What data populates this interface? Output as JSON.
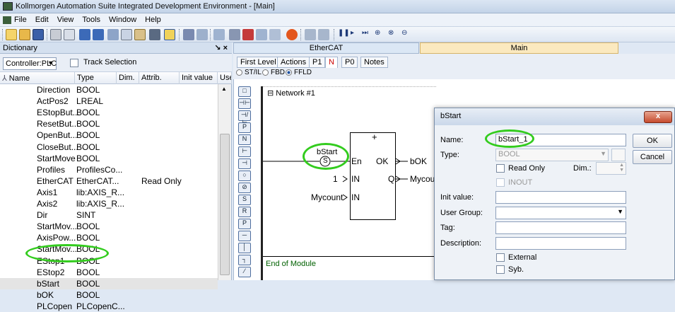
{
  "window": {
    "title": "Kollmorgen Automation Suite Integrated Development Environment - [Main]"
  },
  "menu": [
    "File",
    "Edit",
    "View",
    "Tools",
    "Window",
    "Help"
  ],
  "dictionary": {
    "title": "Dictionary",
    "header_controls": "↘ ×",
    "controller_combo": "Controller:PLC",
    "track_selection_label": "Track Selection",
    "columns": [
      "Name",
      "Type",
      "Dim.",
      "Attrib.",
      "Init value",
      "Use"
    ],
    "rows": [
      {
        "name": "Direction",
        "type": "BOOL",
        "attrib": ""
      },
      {
        "name": "ActPos2",
        "type": "LREAL",
        "attrib": ""
      },
      {
        "name": "EStopBut...",
        "type": "BOOL",
        "attrib": ""
      },
      {
        "name": "ResetBut...",
        "type": "BOOL",
        "attrib": ""
      },
      {
        "name": "OpenBut...",
        "type": "BOOL",
        "attrib": ""
      },
      {
        "name": "CloseBut...",
        "type": "BOOL",
        "attrib": ""
      },
      {
        "name": "StartMove",
        "type": "BOOL",
        "attrib": ""
      },
      {
        "name": "Profiles",
        "type": "ProfilesCo...",
        "attrib": ""
      },
      {
        "name": "EtherCAT",
        "type": "EtherCAT...",
        "attrib": "Read Only"
      },
      {
        "name": "Axis1",
        "type": "lib:AXIS_R...",
        "attrib": ""
      },
      {
        "name": "Axis2",
        "type": "lib:AXIS_R...",
        "attrib": ""
      },
      {
        "name": "Dir",
        "type": "SINT",
        "attrib": ""
      },
      {
        "name": "StartMov...",
        "type": "BOOL",
        "attrib": ""
      },
      {
        "name": "AxisPow...",
        "type": "BOOL",
        "attrib": ""
      },
      {
        "name": "StartMov...",
        "type": "BOOL",
        "attrib": ""
      },
      {
        "name": "EStop1",
        "type": "BOOL",
        "attrib": ""
      },
      {
        "name": "EStop2",
        "type": "BOOL",
        "attrib": ""
      },
      {
        "name": "bStart",
        "type": "BOOL",
        "attrib": ""
      },
      {
        "name": "bOK",
        "type": "BOOL",
        "attrib": ""
      },
      {
        "name": "PLCopen",
        "type": "PLCopenC...",
        "attrib": ""
      }
    ]
  },
  "doc_tabs": {
    "ethercat": "EtherCAT",
    "main": "Main"
  },
  "sub_tabs": [
    "First Level",
    "Actions",
    "P1",
    "N",
    "P0",
    "Notes"
  ],
  "language": {
    "st": "ST/IL",
    "fbd": "FBD",
    "ffld": "FFLD"
  },
  "editor": {
    "network_label": "⊟ Network #1",
    "end_label": "End of Module",
    "block": {
      "plus": "+",
      "contact_var": "bStart",
      "contact_symbol": "S",
      "in_en": "En",
      "out_ok": "OK",
      "in_in1": "IN",
      "out_q": "Q",
      "in_in2": "IN",
      "const_1": "1",
      "var_mycount_in": "Mycount",
      "var_bok": "bOK",
      "var_mycount_out": "Mycount"
    }
  },
  "dialog": {
    "title": "bStart",
    "close_label": "x",
    "name_label": "Name:",
    "name_value": "bStart_1",
    "type_label": "Type:",
    "type_value": "BOOL",
    "read_only_label": "Read Only",
    "dim_label": "Dim.:",
    "inout_label": "INOUT",
    "init_label": "Init value:",
    "group_label": "User Group:",
    "tag_label": "Tag:",
    "desc_label": "Description:",
    "external_label": "External",
    "syb_label": "Syb.",
    "ok_label": "OK",
    "cancel_label": "Cancel"
  }
}
